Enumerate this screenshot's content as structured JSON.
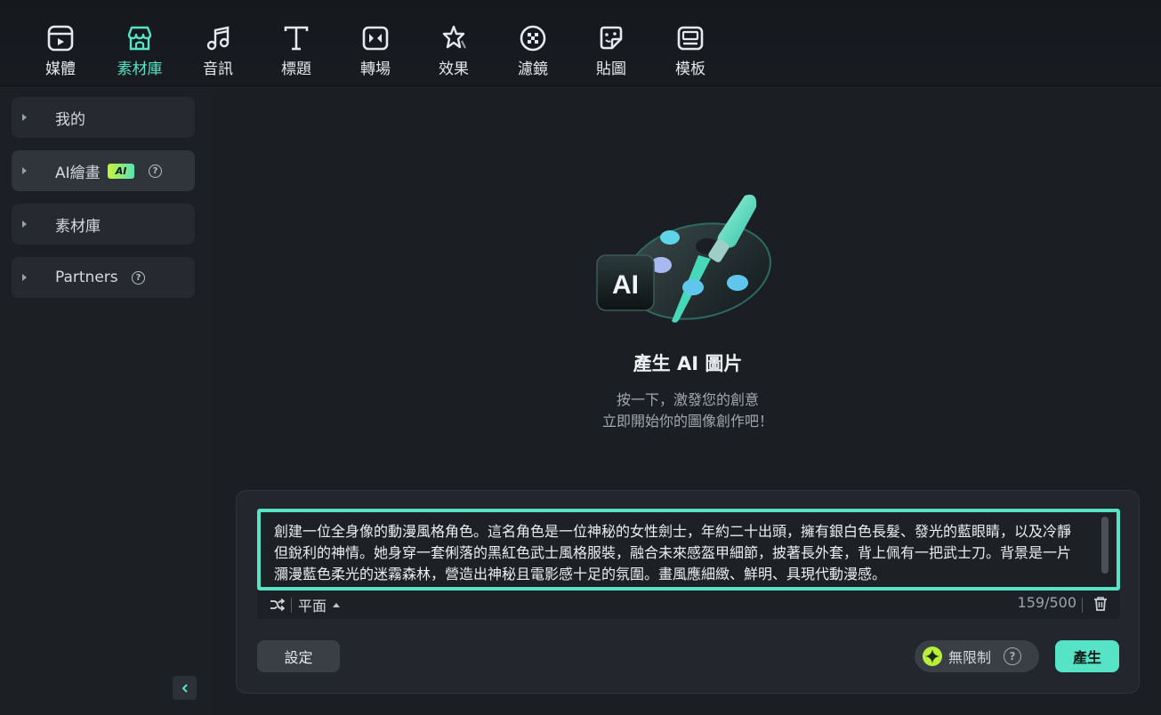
{
  "toolbar": {
    "tabs": [
      {
        "label": "媒體",
        "icon": "media-icon"
      },
      {
        "label": "素材庫",
        "icon": "stock-store-icon"
      },
      {
        "label": "音訊",
        "icon": "music-note-icon"
      },
      {
        "label": "標題",
        "icon": "text-t-icon"
      },
      {
        "label": "轉場",
        "icon": "transition-icon"
      },
      {
        "label": "效果",
        "icon": "effects-star-icon"
      },
      {
        "label": "濾鏡",
        "icon": "filter-icon"
      },
      {
        "label": "貼圖",
        "icon": "sticker-icon"
      },
      {
        "label": "模板",
        "icon": "template-icon"
      }
    ],
    "active_tab": "素材庫",
    "accent_color": "#57e3c5"
  },
  "sidebar": {
    "items": [
      {
        "label": "我的"
      },
      {
        "label": "AI繪畫",
        "badge": "AI",
        "has_help": true
      },
      {
        "label": "素材庫"
      },
      {
        "label": "Partners",
        "has_help": true
      }
    ],
    "help_glyph": "?"
  },
  "hero": {
    "title": "產生 AI 圖片",
    "subtitle_line1": "按一下，激發您的創意",
    "subtitle_line2": "立即開始你的圖像創作吧！",
    "badge_text": "AI"
  },
  "prompt": {
    "text": "創建一位全身像的動漫風格角色。這名角色是一位神秘的女性劍士，年約二十出頭，擁有銀白色長髮、發光的藍眼睛，以及冷靜但銳利的神情。她身穿一套俐落的黑紅色武士風格服裝，融合未來感盔甲細節，披著長外套，背上佩有一把武士刀。背景是一片瀰漫藍色柔光的迷霧森林，營造出神秘且電影感十足的氛圍。畫風應細緻、鮮明、具現代動漫感。",
    "style": "平面",
    "counter": "159/500"
  },
  "actions": {
    "settings_label": "設定",
    "unlimited_label": "無限制",
    "help_glyph": "?",
    "generate_label": "產生"
  }
}
